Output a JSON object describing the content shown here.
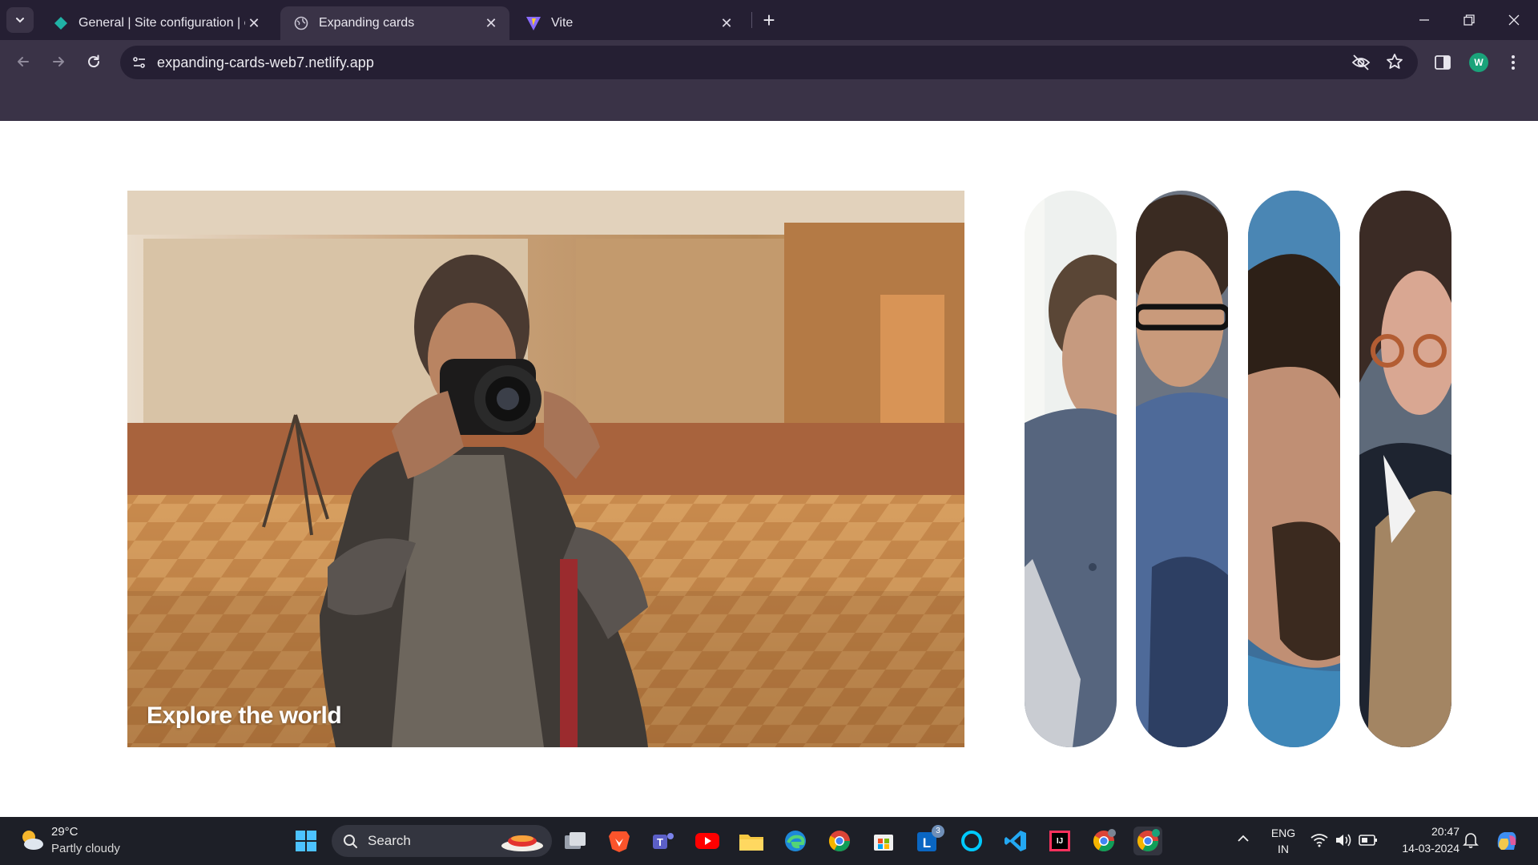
{
  "browser": {
    "tabs": [
      {
        "title": "General | Site configuration | ex",
        "active": false
      },
      {
        "title": "Expanding cards",
        "active": true
      },
      {
        "title": "Vite",
        "active": false
      }
    ],
    "url": "expanding-cards-web7.netlify.app",
    "profile_initial": "W"
  },
  "page": {
    "active_panel_title": "Explore the world",
    "panels": [
      {
        "name": "photographer-panel",
        "active": true
      },
      {
        "name": "man-laptop-panel",
        "active": false
      },
      {
        "name": "man-glasses-panel",
        "active": false
      },
      {
        "name": "man-beard-panel",
        "active": false
      },
      {
        "name": "woman-glasses-panel",
        "active": false
      }
    ]
  },
  "taskbar": {
    "weather_temp": "29°C",
    "weather_desc": "Partly cloudy",
    "search_label": "Search",
    "lang_top": "ENG",
    "lang_bottom": "IN",
    "time": "20:47",
    "date": "14-03-2024",
    "linkedin_badge": "3"
  },
  "colors": {
    "tabstrip": "#251f33",
    "toolbar": "#3a3347",
    "taskbar": "#1d1f27",
    "accent": "#1aa37a"
  }
}
